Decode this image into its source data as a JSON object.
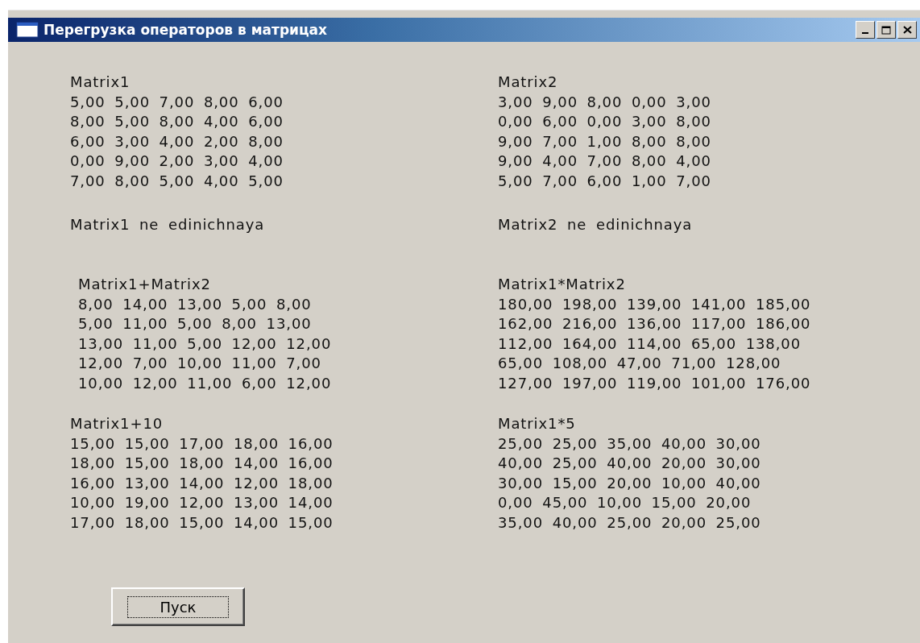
{
  "window": {
    "title": "Перегрузка операторов в матрицах"
  },
  "blocks": [
    {
      "kind": "matrix",
      "title": "Matrix1",
      "rows": [
        "5,00 5,00 7,00 8,00 6,00",
        "8,00 5,00 8,00 4,00 6,00",
        "6,00 3,00 4,00 2,00 8,00",
        "0,00 9,00 2,00 3,00 4,00",
        "7,00 8,00 5,00 4,00 5,00"
      ]
    },
    {
      "kind": "matrix",
      "title": "Matrix2",
      "rows": [
        "3,00 9,00 8,00 0,00 3,00",
        "0,00 6,00 0,00 3,00 8,00",
        "9,00 7,00 1,00 8,00 8,00",
        "9,00 4,00 7,00 8,00 4,00",
        "5,00 7,00 6,00 1,00 7,00"
      ]
    },
    {
      "kind": "note",
      "text": "Matrix1 ne edinichnaya"
    },
    {
      "kind": "note",
      "text": "Matrix2 ne edinichnaya"
    },
    {
      "kind": "matrix",
      "title": "Matrix1+Matrix2",
      "rows": [
        "8,00 14,00 13,00 5,00 8,00",
        "5,00 11,00 5,00 8,00 13,00",
        "13,00 11,00 5,00 12,00 12,00",
        "12,00 7,00 10,00 11,00 7,00",
        "10,00 12,00 11,00 6,00 12,00"
      ]
    },
    {
      "kind": "matrix",
      "title": "Matrix1*Matrix2",
      "rows": [
        "180,00 198,00 139,00 141,00 185,00",
        "162,00 216,00 136,00 117,00 186,00",
        "112,00 164,00 114,00 65,00 138,00",
        "65,00 108,00 47,00 71,00 128,00",
        "127,00 197,00 119,00 101,00 176,00"
      ]
    },
    {
      "kind": "matrix",
      "title": "Matrix1+10",
      "rows": [
        "15,00 15,00 17,00 18,00 16,00",
        "18,00 15,00 18,00 14,00 16,00",
        "16,00 13,00 14,00 12,00 18,00",
        "10,00 19,00 12,00 13,00 14,00",
        "17,00 18,00 15,00 14,00 15,00"
      ]
    },
    {
      "kind": "matrix",
      "title": "Matrix1*5",
      "rows": [
        "25,00 25,00 35,00 40,00 30,00",
        "40,00 25,00 40,00 20,00 30,00",
        "30,00 15,00 20,00 10,00 40,00",
        "0,00 45,00 10,00 15,00 20,00",
        "35,00 40,00 25,00 20,00 25,00"
      ]
    }
  ],
  "button": {
    "label": "Пуск",
    "focused": true
  }
}
